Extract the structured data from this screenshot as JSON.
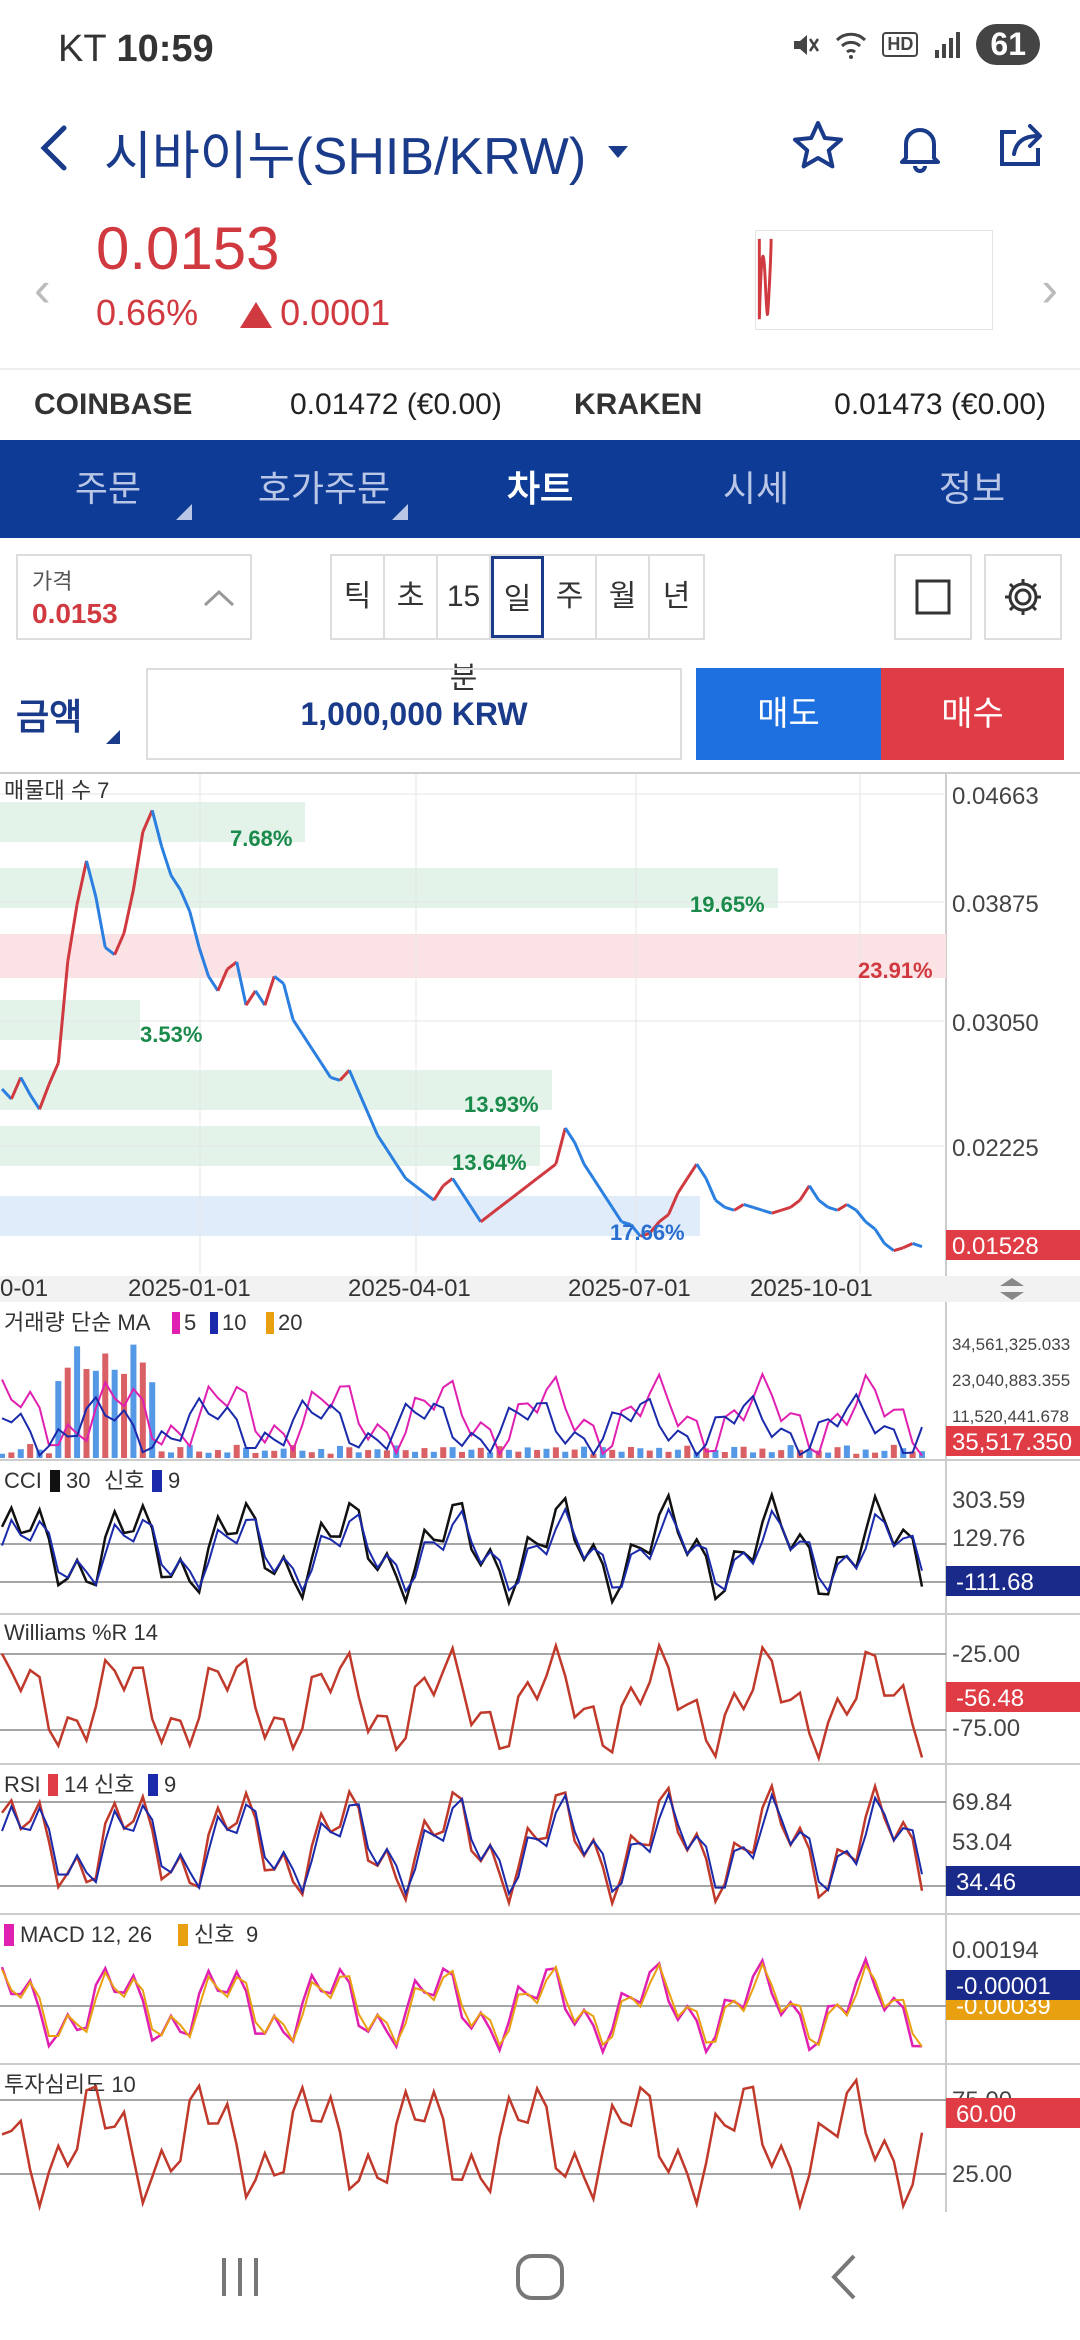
{
  "status": {
    "carrier": "KT",
    "time": "10:59",
    "battery": "61"
  },
  "header": {
    "title": "시바이누(SHIB/KRW)"
  },
  "quote": {
    "price": "0.0153",
    "change_pct": "0.66%",
    "change_abs": "0.0001"
  },
  "exchanges": [
    {
      "name": "COINBASE",
      "value": "0.01472 (€0.00)"
    },
    {
      "name": "KRAKEN",
      "value": "0.01473 (€0.00)"
    }
  ],
  "tabs": [
    "주문",
    "호가주문",
    "차트",
    "시세",
    "정보"
  ],
  "controls": {
    "price_label": "가격",
    "price_value": "0.0153",
    "periods": [
      "틱",
      "초",
      "15분",
      "일",
      "주",
      "월",
      "년"
    ],
    "selected_period": "일"
  },
  "order": {
    "amount_label": "금액",
    "amount_value": "1,000,000 KRW",
    "sell": "매도",
    "buy": "매수"
  },
  "chart_data": {
    "type": "line",
    "main": {
      "title": "매물대 수 7",
      "y_ticks": [
        "0.04663",
        "0.03875",
        "0.03050",
        "0.02225"
      ],
      "current": "0.01528",
      "x_ticks": [
        "0-01",
        "2025-01-01",
        "2025-04-01",
        "2025-07-01",
        "2025-10-01"
      ],
      "volume_profile": [
        "7.68%",
        "19.65%",
        "23.91%",
        "3.53%",
        "13.93%",
        "13.64%",
        "17.66%"
      ],
      "close": [
        0.0262,
        0.0255,
        0.027,
        0.0258,
        0.0248,
        0.0265,
        0.028,
        0.035,
        0.039,
        0.042,
        0.0395,
        0.036,
        0.0355,
        0.037,
        0.04,
        0.044,
        0.0455,
        0.043,
        0.041,
        0.04,
        0.0385,
        0.036,
        0.034,
        0.033,
        0.0345,
        0.035,
        0.032,
        0.033,
        0.032,
        0.034,
        0.0335,
        0.031,
        0.03,
        0.029,
        0.028,
        0.027,
        0.0268,
        0.0275,
        0.026,
        0.0245,
        0.023,
        0.022,
        0.021,
        0.02,
        0.0195,
        0.019,
        0.0185,
        0.0195,
        0.02,
        0.019,
        0.018,
        0.017,
        0.0175,
        0.018,
        0.0185,
        0.019,
        0.0195,
        0.02,
        0.0205,
        0.021,
        0.0235,
        0.0225,
        0.021,
        0.02,
        0.019,
        0.018,
        0.017,
        0.0168,
        0.016,
        0.0162,
        0.017,
        0.0175,
        0.019,
        0.02,
        0.021,
        0.02,
        0.0185,
        0.018,
        0.0178,
        0.0182,
        0.018,
        0.0178,
        0.0176,
        0.0178,
        0.018,
        0.0185,
        0.0195,
        0.0185,
        0.018,
        0.0178,
        0.0182,
        0.0178,
        0.017,
        0.0165,
        0.0155,
        0.015,
        0.0152,
        0.0155,
        0.01528
      ]
    },
    "volume": {
      "title": "거래량 단순 MA",
      "ma": [
        "5",
        "10",
        "20"
      ],
      "y_ticks": [
        "34,561,325.033",
        "23,040,883.355",
        "11,520,441.678"
      ],
      "current": "35,517.350"
    },
    "cci": {
      "title": "CCI",
      "period": "30",
      "signal_label": "신호",
      "signal": "9",
      "y_ticks": [
        "303.59",
        "129.76"
      ],
      "current": "-111.68"
    },
    "williams": {
      "title": "Williams %R 14",
      "y_ticks": [
        "-25.00",
        "-75.00"
      ],
      "current": "-56.48"
    },
    "rsi": {
      "title": "RSI",
      "period": "14",
      "signal_label": "신호",
      "signal": "9",
      "y_ticks": [
        "69.84",
        "53.04"
      ],
      "current": "34.46"
    },
    "macd": {
      "title": "MACD 12, 26",
      "signal_label": "신호",
      "signal": "9",
      "y_ticks": [
        "0.00194"
      ],
      "current": "-0.00001",
      "current2": "-0.00039"
    },
    "psy": {
      "title": "투자심리도 10",
      "y_ticks": [
        "75.00",
        "25.00"
      ],
      "current": "60.00"
    }
  },
  "colors": {
    "navy": "#0e3b96",
    "up": "#d0393f",
    "down": "#1e6fe0",
    "green_zone": "#e3f3ea",
    "red_zone": "#fbe3e5",
    "blue_zone": "#e1ecfa"
  }
}
